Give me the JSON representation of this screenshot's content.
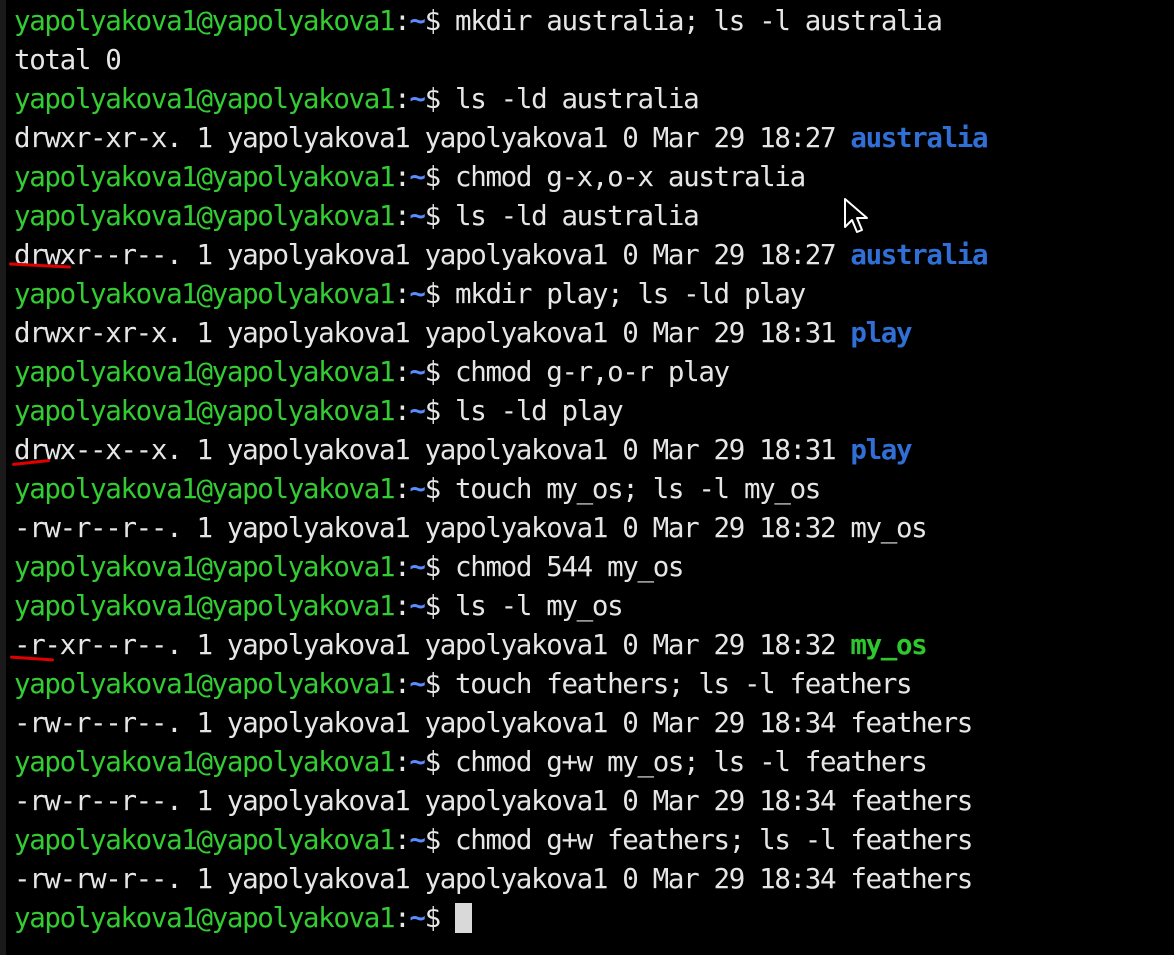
{
  "terminal": {
    "prompt_user": "yapolyakova1@yapolyakova1",
    "prompt_sep": ":",
    "prompt_path": "~",
    "prompt_symbol": "$",
    "lines": [
      {
        "type": "prompt",
        "command": " mkdir australia; ls -l australia"
      },
      {
        "type": "output",
        "text": "total 0"
      },
      {
        "type": "prompt",
        "command": " ls -ld australia"
      },
      {
        "type": "output",
        "text": "drwxr-xr-x. 1 yapolyakova1 yapolyakova1 0 Mar 29 18:27 ",
        "name": "australia",
        "name_style": "dir"
      },
      {
        "type": "prompt",
        "command": " chmod g-x,o-x australia"
      },
      {
        "type": "prompt",
        "command": " ls -ld australia"
      },
      {
        "type": "output",
        "text": "drwxr--r--. 1 yapolyakova1 yapolyakova1 0 Mar 29 18:27 ",
        "name": "australia",
        "name_style": "dir"
      },
      {
        "type": "prompt",
        "command": " mkdir play; ls -ld play"
      },
      {
        "type": "output",
        "text": "drwxr-xr-x. 1 yapolyakova1 yapolyakova1 0 Mar 29 18:31 ",
        "name": "play",
        "name_style": "dir"
      },
      {
        "type": "prompt",
        "command": " chmod g-r,o-r play"
      },
      {
        "type": "prompt",
        "command": " ls -ld play"
      },
      {
        "type": "output",
        "text": "drwx--x--x. 1 yapolyakova1 yapolyakova1 0 Mar 29 18:31 ",
        "name": "play",
        "name_style": "dir"
      },
      {
        "type": "prompt",
        "command": " touch my_os; ls -l my_os"
      },
      {
        "type": "output",
        "text": "-rw-r--r--. 1 yapolyakova1 yapolyakova1 0 Mar 29 18:32 my_os"
      },
      {
        "type": "prompt",
        "command": " chmod 544 my_os"
      },
      {
        "type": "prompt",
        "command": " ls -l my_os"
      },
      {
        "type": "output",
        "text": "-r-xr--r--. 1 yapolyakova1 yapolyakova1 0 Mar 29 18:32 ",
        "name": "my_os",
        "name_style": "exec"
      },
      {
        "type": "prompt",
        "command": " touch feathers; ls -l feathers"
      },
      {
        "type": "output",
        "text": "-rw-r--r--. 1 yapolyakova1 yapolyakova1 0 Mar 29 18:34 feathers"
      },
      {
        "type": "prompt",
        "command": " chmod g+w my_os; ls -l feathers"
      },
      {
        "type": "output",
        "text": "-rw-r--r--. 1 yapolyakova1 yapolyakova1 0 Mar 29 18:34 feathers"
      },
      {
        "type": "prompt",
        "command": " chmod g+w feathers; ls -l feathers"
      },
      {
        "type": "output",
        "text": "-rw-rw-r--. 1 yapolyakova1 yapolyakova1 0 Mar 29 18:34 feathers"
      },
      {
        "type": "prompt",
        "command": " ",
        "cursor": true
      }
    ]
  },
  "colors": {
    "background": "#000000",
    "prompt_user": "#33cc33",
    "prompt_path": "#5a8cff",
    "directory": "#2f6fd6",
    "executable": "#2ec72e",
    "annotation": "#e00000",
    "text": "#e6e6e6"
  },
  "icons": {
    "pointer": "mouse-pointer-icon"
  }
}
